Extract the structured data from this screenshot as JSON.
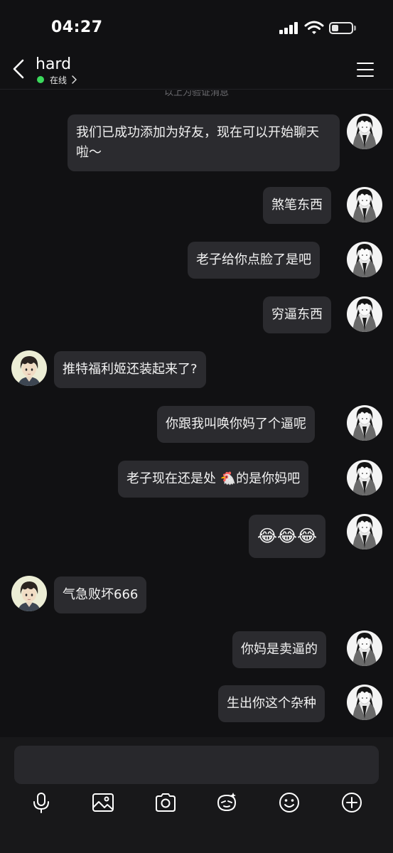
{
  "status_bar": {
    "time": "04:27"
  },
  "header": {
    "contact_name": "hard",
    "status_text": "在线"
  },
  "chat": {
    "verify_note": "以上为验证消息",
    "messages": [
      {
        "sender": "me",
        "text": "我们已成功添加为好友，现在可以开始聊天啦～"
      },
      {
        "sender": "me",
        "text": "煞笔东西"
      },
      {
        "sender": "me",
        "text": "老子给你点脸了是吧"
      },
      {
        "sender": "me",
        "text": "穷逼东西"
      },
      {
        "sender": "other",
        "text": "推特福利姬还装起来了?"
      },
      {
        "sender": "me",
        "text": "你跟我叫唤你妈了个逼呢"
      },
      {
        "sender": "me",
        "text": "老子现在还是处 🐔的是你妈吧"
      },
      {
        "sender": "me",
        "text": "😂😂😂"
      },
      {
        "sender": "other",
        "text": "气急败坏666"
      },
      {
        "sender": "me",
        "text": "你妈是卖逼的"
      },
      {
        "sender": "me",
        "text": "生出你这个杂种"
      }
    ]
  },
  "toolbar": {
    "icons": [
      "microphone-icon",
      "image-icon",
      "camera-icon",
      "sticker-icon",
      "emoji-icon",
      "plus-icon"
    ]
  },
  "colors": {
    "background": "#111113",
    "bubble": "#2b2b2f",
    "online": "#3bd95c",
    "input_bar": "#18181a"
  }
}
